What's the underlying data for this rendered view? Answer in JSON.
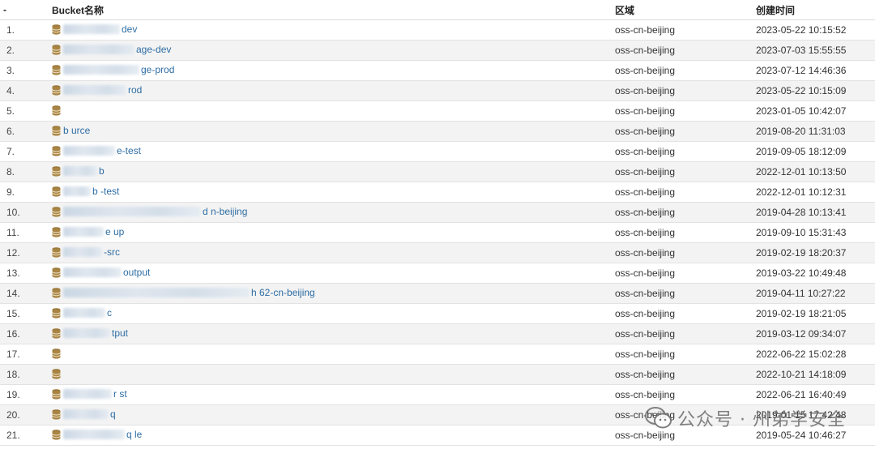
{
  "headers": {
    "index": "-",
    "name": "Bucket名称",
    "region": "区域",
    "created": "创建时间"
  },
  "rows": [
    {
      "index": "1.",
      "name": "dev",
      "region": "oss-cn-beijing",
      "created": "2023-05-22 10:15:52"
    },
    {
      "index": "2.",
      "name": "age-dev",
      "region": "oss-cn-beijing",
      "created": "2023-07-03 15:55:55"
    },
    {
      "index": "3.",
      "name": "ge-prod",
      "region": "oss-cn-beijing",
      "created": "2023-07-12 14:46:36"
    },
    {
      "index": "4.",
      "name": "rod",
      "region": "oss-cn-beijing",
      "created": "2023-05-22 10:15:09"
    },
    {
      "index": "5.",
      "name": "",
      "region": "oss-cn-beijing",
      "created": "2023-01-05 10:42:07"
    },
    {
      "index": "6.",
      "name": "b urce",
      "region": "oss-cn-beijing",
      "created": "2019-08-20 11:31:03"
    },
    {
      "index": "7.",
      "name": "e-test",
      "region": "oss-cn-beijing",
      "created": "2019-09-05 18:12:09"
    },
    {
      "index": "8.",
      "name": "b",
      "region": "oss-cn-beijing",
      "created": "2022-12-01 10:13:50"
    },
    {
      "index": "9.",
      "name": "b -test",
      "region": "oss-cn-beijing",
      "created": "2022-12-01 10:12:31"
    },
    {
      "index": "10.",
      "name": "d n-beijing",
      "region": "oss-cn-beijing",
      "created": "2019-04-28 10:13:41"
    },
    {
      "index": "11.",
      "name": "e up",
      "region": "oss-cn-beijing",
      "created": "2019-09-10 15:31:43"
    },
    {
      "index": "12.",
      "name": "-src",
      "region": "oss-cn-beijing",
      "created": "2019-02-19 18:20:37"
    },
    {
      "index": "13.",
      "name": "output",
      "region": "oss-cn-beijing",
      "created": "2019-03-22 10:49:48"
    },
    {
      "index": "14.",
      "name": "h 62-cn-beijing",
      "region": "oss-cn-beijing",
      "created": "2019-04-11 10:27:22"
    },
    {
      "index": "15.",
      "name": "c",
      "region": "oss-cn-beijing",
      "created": "2019-02-19 18:21:05"
    },
    {
      "index": "16.",
      "name": "tput",
      "region": "oss-cn-beijing",
      "created": "2019-03-12 09:34:07"
    },
    {
      "index": "17.",
      "name": "",
      "region": "oss-cn-beijing",
      "created": "2022-06-22 15:02:28"
    },
    {
      "index": "18.",
      "name": "",
      "region": "oss-cn-beijing",
      "created": "2022-10-21 14:18:09"
    },
    {
      "index": "19.",
      "name": "r st",
      "region": "oss-cn-beijing",
      "created": "2022-06-21 16:40:49"
    },
    {
      "index": "20.",
      "name": "q",
      "region": "oss-cn-beijing",
      "created": "2019-01-15 17:42:48"
    },
    {
      "index": "21.",
      "name": "q le",
      "region": "oss-cn-beijing",
      "created": "2019-05-24 10:46:27"
    }
  ],
  "watermark": {
    "text": "公众号 · 州弟学安全",
    "icon": "wechat-icon"
  },
  "colors": {
    "link": "#2e6da4",
    "bucket_icon": "#9c7a3c",
    "stripe": "#f3f3f3"
  }
}
